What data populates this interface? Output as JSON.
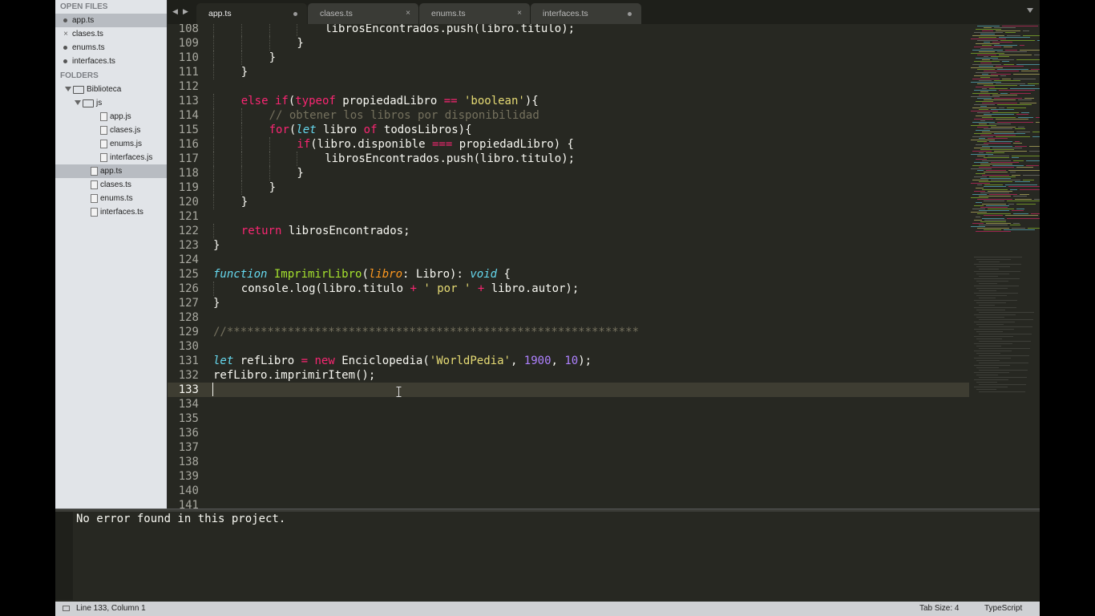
{
  "sidebar": {
    "open_files_header": "OPEN FILES",
    "open_files": [
      {
        "name": "app.ts",
        "selected": true,
        "mark": "dot"
      },
      {
        "name": "clases.ts",
        "selected": false,
        "mark": "close"
      },
      {
        "name": "enums.ts",
        "selected": false,
        "mark": "dot"
      },
      {
        "name": "interfaces.ts",
        "selected": false,
        "mark": "dot"
      }
    ],
    "close_glyph": "×",
    "folders_header": "FOLDERS",
    "tree": [
      {
        "name": "Biblioteca",
        "type": "folder",
        "depth": 0,
        "expanded": true
      },
      {
        "name": "js",
        "type": "folder",
        "depth": 1,
        "expanded": true
      },
      {
        "name": "app.js",
        "type": "file",
        "depth": 2
      },
      {
        "name": "clases.js",
        "type": "file",
        "depth": 2
      },
      {
        "name": "enums.js",
        "type": "file",
        "depth": 2
      },
      {
        "name": "interfaces.js",
        "type": "file",
        "depth": 2
      },
      {
        "name": "app.ts",
        "type": "file",
        "depth": 1,
        "selected": true
      },
      {
        "name": "clases.ts",
        "type": "file",
        "depth": 1
      },
      {
        "name": "enums.ts",
        "type": "file",
        "depth": 1
      },
      {
        "name": "interfaces.ts",
        "type": "file",
        "depth": 1
      }
    ]
  },
  "tabs": [
    {
      "label": "app.ts",
      "active": true,
      "mark": "dot"
    },
    {
      "label": "clases.ts",
      "active": false,
      "mark": "close"
    },
    {
      "label": "enums.ts",
      "active": false,
      "mark": "close"
    },
    {
      "label": "interfaces.ts",
      "active": false,
      "mark": "dot"
    }
  ],
  "nav": {
    "back": "◀",
    "forward": "▶"
  },
  "editor": {
    "current_line": 133,
    "lines": [
      {
        "n": "108",
        "indent": 4,
        "tokens": [
          [
            "",
            "librosEncontrados.push(libro.titulo);"
          ]
        ]
      },
      {
        "n": "109",
        "indent": 3,
        "tokens": [
          [
            "",
            "}"
          ]
        ]
      },
      {
        "n": "110",
        "indent": 2,
        "tokens": [
          [
            "",
            "}"
          ]
        ]
      },
      {
        "n": "111",
        "indent": 1,
        "tokens": [
          [
            "",
            "}"
          ]
        ]
      },
      {
        "n": "112",
        "indent": 0,
        "tokens": []
      },
      {
        "n": "113",
        "indent": 1,
        "tokens": [
          [
            "kw",
            "else if"
          ],
          [
            "",
            "("
          ],
          [
            "kw",
            "typeof"
          ],
          [
            "",
            " propiedadLibro "
          ],
          [
            "kw",
            "=="
          ],
          [
            "",
            " "
          ],
          [
            "str",
            "'boolean'"
          ],
          [
            "",
            "){"
          ]
        ]
      },
      {
        "n": "114",
        "indent": 2,
        "tokens": [
          [
            "cmt",
            "// obtener los libros por disponibilidad"
          ]
        ]
      },
      {
        "n": "115",
        "indent": 2,
        "tokens": [
          [
            "kw",
            "for"
          ],
          [
            "",
            "("
          ],
          [
            "kwi",
            "let"
          ],
          [
            "",
            " libro "
          ],
          [
            "kw",
            "of"
          ],
          [
            "",
            " todosLibros){"
          ]
        ]
      },
      {
        "n": "116",
        "indent": 3,
        "tokens": [
          [
            "kw",
            "if"
          ],
          [
            "",
            "(libro.disponible "
          ],
          [
            "kw",
            "==="
          ],
          [
            "",
            " propiedadLibro) {"
          ]
        ]
      },
      {
        "n": "117",
        "indent": 4,
        "tokens": [
          [
            "",
            "librosEncontrados.push(libro.titulo);"
          ]
        ]
      },
      {
        "n": "118",
        "indent": 3,
        "tokens": [
          [
            "",
            "}"
          ]
        ]
      },
      {
        "n": "119",
        "indent": 2,
        "tokens": [
          [
            "",
            "}"
          ]
        ]
      },
      {
        "n": "120",
        "indent": 1,
        "tokens": [
          [
            "",
            "}"
          ]
        ]
      },
      {
        "n": "121",
        "indent": 0,
        "tokens": []
      },
      {
        "n": "122",
        "indent": 1,
        "tokens": [
          [
            "kw",
            "return"
          ],
          [
            "",
            " librosEncontrados;"
          ]
        ]
      },
      {
        "n": "123",
        "indent": 0,
        "tokens": [
          [
            "",
            "}"
          ]
        ]
      },
      {
        "n": "124",
        "indent": 0,
        "tokens": []
      },
      {
        "n": "125",
        "indent": 0,
        "tokens": [
          [
            "kwi",
            "function"
          ],
          [
            "",
            " "
          ],
          [
            "fn",
            "ImprimirLibro"
          ],
          [
            "",
            "("
          ],
          [
            "param",
            "libro"
          ],
          [
            "",
            ": Libro): "
          ],
          [
            "kwi",
            "void"
          ],
          [
            "",
            " {"
          ]
        ]
      },
      {
        "n": "126",
        "indent": 1,
        "tokens": [
          [
            "",
            "console.log(libro.titulo "
          ],
          [
            "kw",
            "+"
          ],
          [
            "",
            " "
          ],
          [
            "str",
            "' por '"
          ],
          [
            "",
            " "
          ],
          [
            "kw",
            "+"
          ],
          [
            "",
            " libro.autor);"
          ]
        ]
      },
      {
        "n": "127",
        "indent": 0,
        "tokens": [
          [
            "",
            "}"
          ]
        ]
      },
      {
        "n": "128",
        "indent": 0,
        "tokens": []
      },
      {
        "n": "129",
        "indent": 0,
        "tokens": [
          [
            "cmt",
            "//*************************************************************"
          ]
        ]
      },
      {
        "n": "130",
        "indent": 0,
        "tokens": []
      },
      {
        "n": "131",
        "indent": 0,
        "tokens": [
          [
            "kwi",
            "let"
          ],
          [
            "",
            " refLibro "
          ],
          [
            "kw",
            "="
          ],
          [
            "",
            " "
          ],
          [
            "kw",
            "new"
          ],
          [
            "",
            " Enciclopedia("
          ],
          [
            "str",
            "'WorldPedia'"
          ],
          [
            "",
            ", "
          ],
          [
            "num",
            "1900"
          ],
          [
            "",
            ", "
          ],
          [
            "num",
            "10"
          ],
          [
            "",
            ");"
          ]
        ]
      },
      {
        "n": "132",
        "indent": 0,
        "tokens": [
          [
            "",
            "refLibro.imprimirItem();"
          ]
        ]
      },
      {
        "n": "133",
        "indent": 0,
        "tokens": []
      },
      {
        "n": "134",
        "indent": 0,
        "tokens": []
      },
      {
        "n": "135",
        "indent": 0,
        "tokens": []
      },
      {
        "n": "136",
        "indent": 0,
        "tokens": []
      },
      {
        "n": "137",
        "indent": 0,
        "tokens": []
      },
      {
        "n": "138",
        "indent": 0,
        "tokens": []
      },
      {
        "n": "139",
        "indent": 0,
        "tokens": []
      },
      {
        "n": "140",
        "indent": 0,
        "tokens": []
      },
      {
        "n": "141",
        "indent": 0,
        "tokens": []
      }
    ]
  },
  "output": {
    "message": "No error found in this project."
  },
  "status": {
    "position": "Line 133, Column 1",
    "tab_size": "Tab Size: 4",
    "syntax": "TypeScript"
  },
  "colors": {
    "background": "#272822",
    "keyword": "#f92672",
    "string": "#e6db74",
    "number": "#ae81ff",
    "function": "#a6e22e",
    "storage": "#66d9ef",
    "comment": "#75715e"
  }
}
